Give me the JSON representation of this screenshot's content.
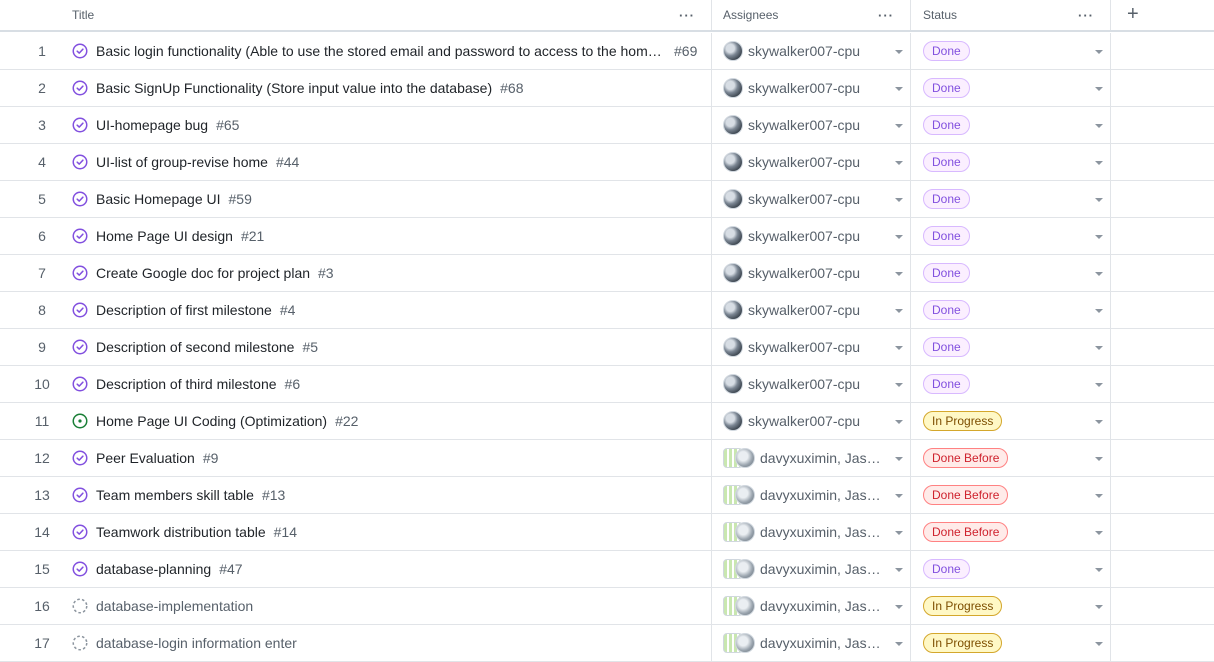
{
  "header": {
    "title_label": "Title",
    "assignees_label": "Assignees",
    "status_label": "Status",
    "menu_glyph": "···",
    "add_glyph": "+"
  },
  "colors": {
    "done": "#8250df",
    "in_progress": "#7d4e00",
    "done_before": "#cf222e",
    "closed_icon": "#8250df",
    "open_icon": "#1a7f37"
  },
  "rows": [
    {
      "num": "1",
      "title": "Basic login functionality (Able to use the stored email and password to access to the home…",
      "issue": "#69",
      "icon": "issue-closed-icon",
      "assignee": "skywalker007-cpu",
      "avatar": "single",
      "status": "Done",
      "status_kind": "done"
    },
    {
      "num": "2",
      "title": "Basic SignUp Functionality (Store input value into the database)",
      "issue": "#68",
      "icon": "issue-closed-icon",
      "assignee": "skywalker007-cpu",
      "avatar": "single",
      "status": "Done",
      "status_kind": "done"
    },
    {
      "num": "3",
      "title": "UI-homepage bug",
      "issue": "#65",
      "icon": "issue-closed-icon",
      "assignee": "skywalker007-cpu",
      "avatar": "single",
      "status": "Done",
      "status_kind": "done"
    },
    {
      "num": "4",
      "title": "UI-list of group-revise home",
      "issue": "#44",
      "icon": "issue-closed-icon",
      "assignee": "skywalker007-cpu",
      "avatar": "single",
      "status": "Done",
      "status_kind": "done"
    },
    {
      "num": "5",
      "title": "Basic Homepage UI",
      "issue": "#59",
      "icon": "issue-closed-icon",
      "assignee": "skywalker007-cpu",
      "avatar": "single",
      "status": "Done",
      "status_kind": "done"
    },
    {
      "num": "6",
      "title": "Home Page UI design",
      "issue": "#21",
      "icon": "issue-closed-icon",
      "assignee": "skywalker007-cpu",
      "avatar": "single",
      "status": "Done",
      "status_kind": "done"
    },
    {
      "num": "7",
      "title": "Create Google doc for project plan",
      "issue": "#3",
      "icon": "issue-closed-icon",
      "assignee": "skywalker007-cpu",
      "avatar": "single",
      "status": "Done",
      "status_kind": "done"
    },
    {
      "num": "8",
      "title": "Description of first milestone",
      "issue": "#4",
      "icon": "issue-closed-icon",
      "assignee": "skywalker007-cpu",
      "avatar": "single",
      "status": "Done",
      "status_kind": "done"
    },
    {
      "num": "9",
      "title": "Description of second milestone",
      "issue": "#5",
      "icon": "issue-closed-icon",
      "assignee": "skywalker007-cpu",
      "avatar": "single",
      "status": "Done",
      "status_kind": "done"
    },
    {
      "num": "10",
      "title": "Description of third milestone",
      "issue": "#6",
      "icon": "issue-closed-icon",
      "assignee": "skywalker007-cpu",
      "avatar": "single",
      "status": "Done",
      "status_kind": "done"
    },
    {
      "num": "11",
      "title": "Home Page UI Coding (Optimization)",
      "issue": "#22",
      "icon": "issue-open-icon",
      "assignee": "skywalker007-cpu",
      "avatar": "single",
      "status": "In Progress",
      "status_kind": "inprog"
    },
    {
      "num": "12",
      "title": "Peer Evaluation",
      "issue": "#9",
      "icon": "issue-closed-icon",
      "assignee": "davyxuximin, Jases…",
      "avatar": "multi",
      "status": "Done Before",
      "status_kind": "before"
    },
    {
      "num": "13",
      "title": "Team members skill table",
      "issue": "#13",
      "icon": "issue-closed-icon",
      "assignee": "davyxuximin, Jases…",
      "avatar": "multi",
      "status": "Done Before",
      "status_kind": "before"
    },
    {
      "num": "14",
      "title": "Teamwork distribution table",
      "issue": "#14",
      "icon": "issue-closed-icon",
      "assignee": "davyxuximin, Jases…",
      "avatar": "multi",
      "status": "Done Before",
      "status_kind": "before"
    },
    {
      "num": "15",
      "title": "database-planning",
      "issue": "#47",
      "icon": "issue-closed-icon",
      "assignee": "davyxuximin, Jases…",
      "avatar": "multi",
      "status": "Done",
      "status_kind": "done"
    },
    {
      "num": "16",
      "title": "database-implementation",
      "issue": "",
      "icon": "draft-issue-icon",
      "assignee": "davyxuximin, Jases…",
      "avatar": "multi",
      "status": "In Progress",
      "status_kind": "inprog"
    },
    {
      "num": "17",
      "title": "database-login information enter",
      "issue": "",
      "icon": "draft-issue-icon",
      "assignee": "davyxuximin, Jases…",
      "avatar": "multi",
      "status": "In Progress",
      "status_kind": "inprog"
    }
  ]
}
